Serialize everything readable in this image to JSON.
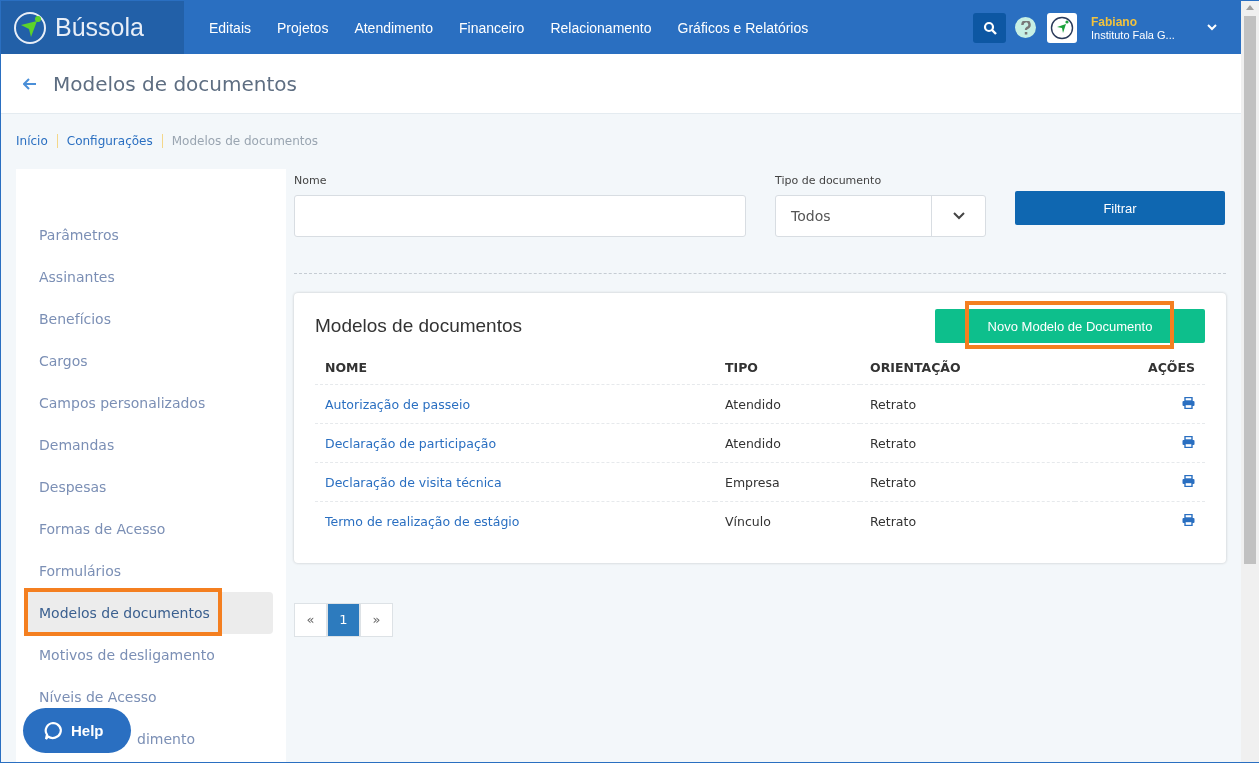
{
  "topbar": {
    "brand": "Bússola",
    "nav": [
      {
        "label": "Editais"
      },
      {
        "label": "Projetos"
      },
      {
        "label": "Atendimento"
      },
      {
        "label": "Financeiro"
      },
      {
        "label": "Relacionamento"
      },
      {
        "label": "Gráficos e Relatórios"
      }
    ],
    "user": {
      "name": "Fabiano",
      "org": "Instituto Fala G..."
    }
  },
  "page_title": "Modelos de documentos",
  "breadcrumb": [
    {
      "label": "Início",
      "current": false
    },
    {
      "label": "Configurações",
      "current": false
    },
    {
      "label": "Modelos de documentos",
      "current": true
    }
  ],
  "sidebar": {
    "items": [
      {
        "label": "Parâmetros",
        "selected": false,
        "highlighted": false
      },
      {
        "label": "Assinantes",
        "selected": false,
        "highlighted": false
      },
      {
        "label": "Benefícios",
        "selected": false,
        "highlighted": false
      },
      {
        "label": "Cargos",
        "selected": false,
        "highlighted": false
      },
      {
        "label": "Campos personalizados",
        "selected": false,
        "highlighted": false
      },
      {
        "label": "Demandas",
        "selected": false,
        "highlighted": false
      },
      {
        "label": "Despesas",
        "selected": false,
        "highlighted": false
      },
      {
        "label": "Formas de Acesso",
        "selected": false,
        "highlighted": false
      },
      {
        "label": "Formulários",
        "selected": false,
        "highlighted": false
      },
      {
        "label": "Modelos de documentos",
        "selected": true,
        "highlighted": true
      },
      {
        "label": "Motivos de desligamento",
        "selected": false,
        "highlighted": false
      },
      {
        "label": "Níveis de Acesso",
        "selected": false,
        "highlighted": false
      },
      {
        "label": "dimento",
        "selected": false,
        "highlighted": false
      }
    ]
  },
  "filters": {
    "name": {
      "label": "Nome"
    },
    "type": {
      "label": "Tipo de documento",
      "value": "Todos"
    },
    "button": "Filtrar"
  },
  "card": {
    "title": "Modelos de documentos",
    "new_button": {
      "label": "Novo Modelo de Documento",
      "highlighted": true
    },
    "columns": [
      "NOME",
      "TIPO",
      "ORIENTAÇÃO",
      "AÇÕES"
    ],
    "rows": [
      {
        "name": "Autorização de passeio",
        "type": "Atendido",
        "orientation": "Retrato"
      },
      {
        "name": "Declaração de participação",
        "type": "Atendido",
        "orientation": "Retrato"
      },
      {
        "name": "Declaração de visita técnica",
        "type": "Empresa",
        "orientation": "Retrato"
      },
      {
        "name": "Termo de realização de estágio",
        "type": "Vínculo",
        "orientation": "Retrato"
      }
    ]
  },
  "pagination": {
    "prev": "«",
    "pages": [
      {
        "label": "1",
        "selected": true
      }
    ],
    "next": "»"
  },
  "help_button": "Help"
}
